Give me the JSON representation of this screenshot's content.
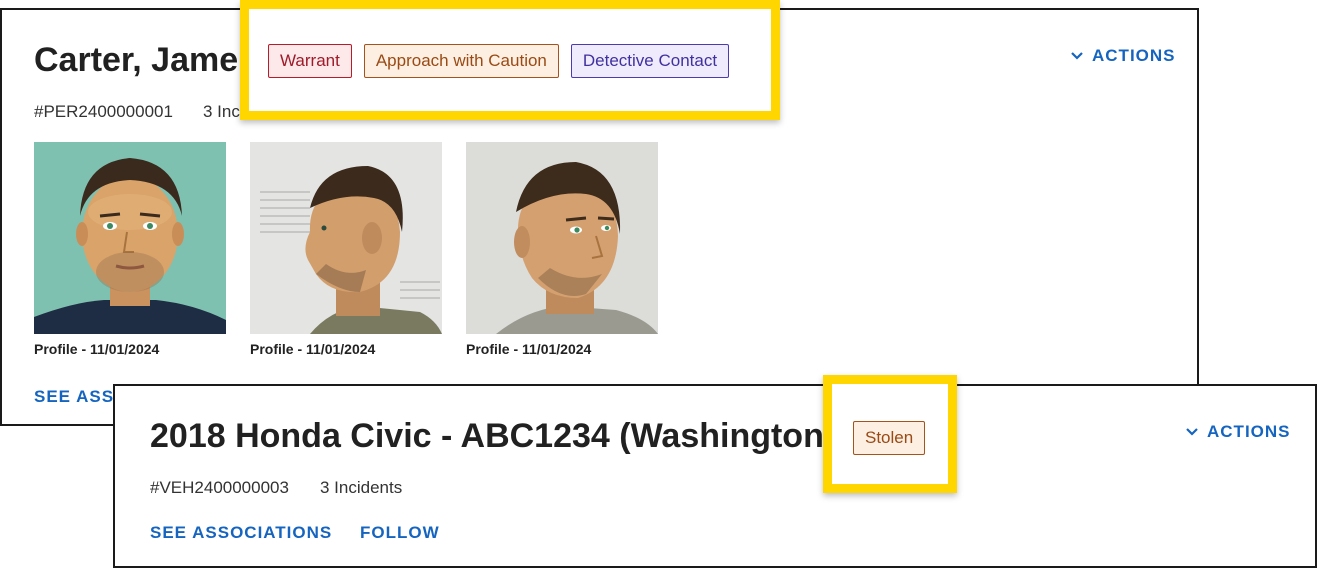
{
  "person": {
    "name": "Carter, Jame",
    "id": "#PER2400000001",
    "incidents": "3 Inci",
    "actions_label": "ACTIONS",
    "see_associations": "SEE ASSO",
    "tags": [
      "Warrant",
      "Approach with Caution",
      "Detective Contact"
    ],
    "photos": [
      {
        "caption": "Profile - 11/01/2024",
        "view": "front",
        "bg": "#7fc1b0"
      },
      {
        "caption": "Profile - 11/01/2024",
        "view": "side",
        "bg": "#e4e4e2"
      },
      {
        "caption": "Profile - 11/01/2024",
        "view": "three-quarter",
        "bg": "#dcdcd8"
      }
    ]
  },
  "vehicle": {
    "title": "2018 Honda Civic - ABC1234 (Washington",
    "id": "#VEH2400000003",
    "incidents": "3 Incidents",
    "actions_label": "ACTIONS",
    "see_associations": "SEE ASSOCIATIONS",
    "follow": "FOLLOW",
    "tag": "Stolen"
  },
  "colors": {
    "accent": "#1565c0",
    "highlight": "#ffd600",
    "warrant": "#b71c2b",
    "caution": "#a5521d",
    "detective": "#4b3bb0"
  },
  "icons": {
    "actions": "chevron-down-icon"
  }
}
